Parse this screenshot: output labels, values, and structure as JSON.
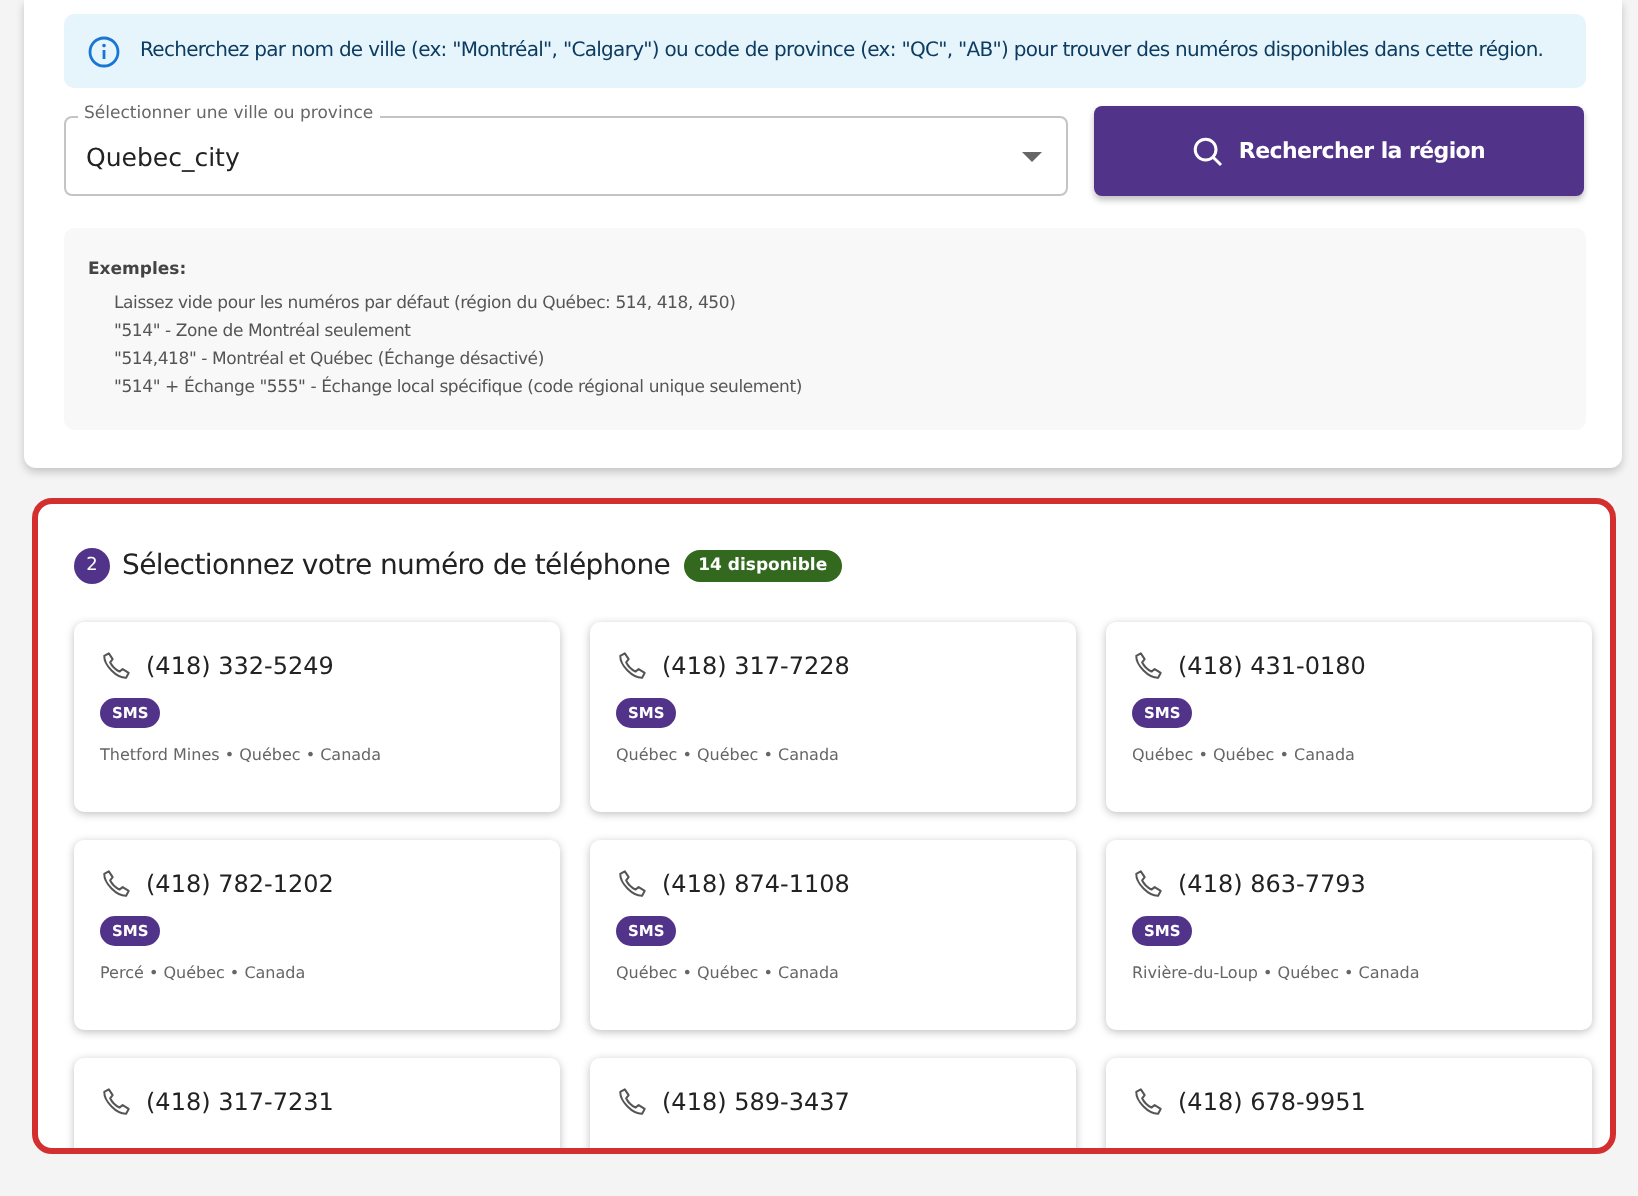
{
  "info": {
    "text": "Recherchez par nom de ville (ex: \"Montréal\", \"Calgary\") ou code de province (ex: \"QC\", \"AB\") pour trouver des numéros disponibles dans cette région."
  },
  "search": {
    "label": "Sélectionner une ville ou province",
    "value": "Quebec_city",
    "button": "Rechercher la région"
  },
  "examples": {
    "title": "Exemples:",
    "lines": [
      "Laissez vide pour les numéros par défaut (région du Québec: 514, 418, 450)",
      "\"514\" - Zone de Montréal seulement",
      "\"514,418\" - Montréal et Québec (Échange désactivé)",
      "\"514\" + Échange \"555\" - Échange local spécifique (code régional unique seulement)"
    ]
  },
  "numbers_section": {
    "step": "2",
    "title": "Sélectionnez votre numéro de téléphone",
    "badge": "14 disponible",
    "highlighted": true,
    "numbers": [
      {
        "number": "(418) 332-5249",
        "tag": "SMS",
        "location": "Thetford Mines • Québec • Canada"
      },
      {
        "number": "(418) 317-7228",
        "tag": "SMS",
        "location": "Québec • Québec • Canada"
      },
      {
        "number": "(418) 431-0180",
        "tag": "SMS",
        "location": "Québec • Québec • Canada"
      },
      {
        "number": "(418) 782-1202",
        "tag": "SMS",
        "location": "Percé • Québec • Canada"
      },
      {
        "number": "(418) 874-1108",
        "tag": "SMS",
        "location": "Québec • Québec • Canada"
      },
      {
        "number": "(418) 863-7793",
        "tag": "SMS",
        "location": "Rivière-du-Loup • Québec • Canada"
      },
      {
        "number": "(418) 317-7231"
      },
      {
        "number": "(418) 589-3437"
      },
      {
        "number": "(418) 678-9951"
      }
    ]
  }
}
